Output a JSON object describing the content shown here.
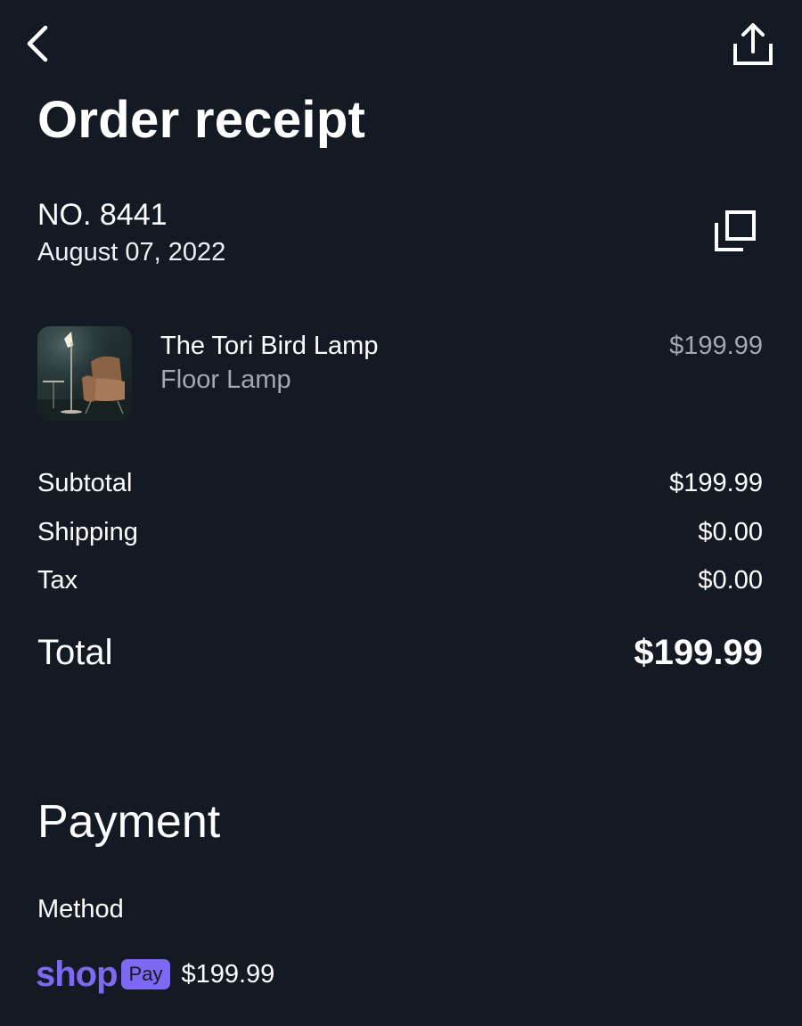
{
  "header": {
    "back_icon": "chevron-left-icon",
    "share_icon": "share-upload-icon",
    "title": "Order receipt"
  },
  "order": {
    "number": "NO. 8441",
    "date": "August 07, 2022",
    "copy_icon": "copy-icon"
  },
  "item": {
    "name": "The Tori Bird Lamp",
    "type": "Floor Lamp",
    "price": "$199.99",
    "thumbnail_icon": "lamp-chair-photo"
  },
  "summary": {
    "subtotal_label": "Subtotal",
    "subtotal_value": "$199.99",
    "shipping_label": "Shipping",
    "shipping_value": "$0.00",
    "tax_label": "Tax",
    "tax_value": "$0.00",
    "total_label": "Total",
    "total_value": "$199.99"
  },
  "payment": {
    "title": "Payment",
    "method_label": "Method",
    "provider_word": "shop",
    "provider_badge": "Pay",
    "amount": "$199.99"
  },
  "colors": {
    "background": "#141a24",
    "text": "#ffffff",
    "muted_text": "#a2a8b2",
    "shop_pay_purple": "#7d69f2"
  }
}
